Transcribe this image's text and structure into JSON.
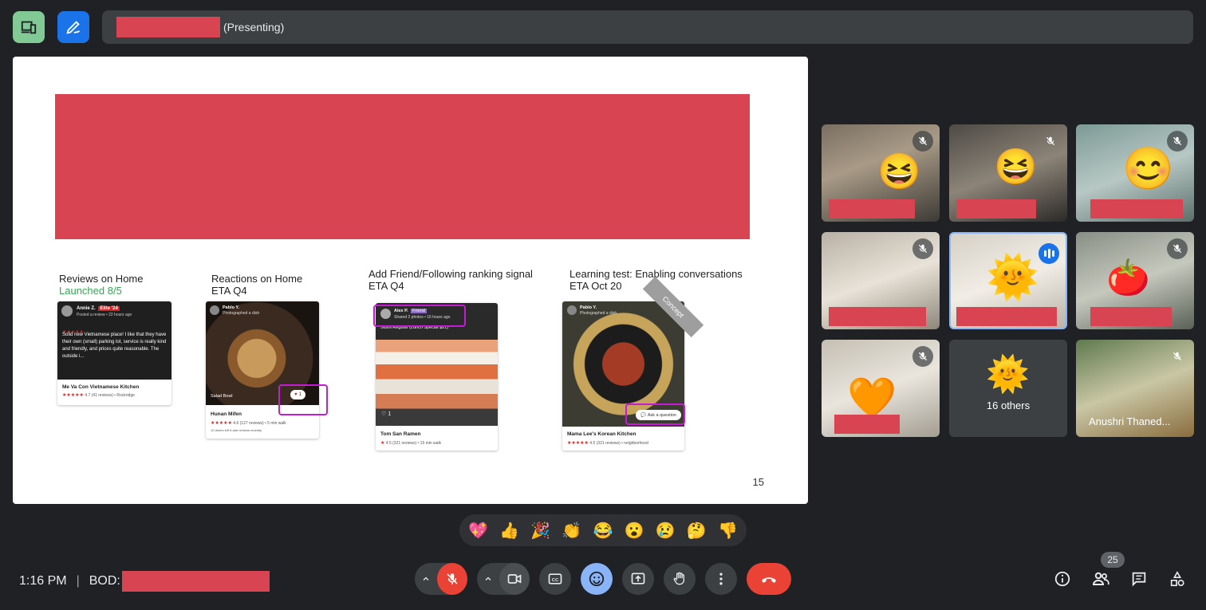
{
  "topbar": {
    "presenting_label": "(Presenting)"
  },
  "slide": {
    "page_number": "15",
    "concept_label": "Concept",
    "features": [
      {
        "title": "Reviews on Home",
        "subtitle": "Launched 8/5"
      },
      {
        "title": "Reactions on Home",
        "subtitle": "ETA Q4"
      },
      {
        "title": "Add Friend/Following ranking signal",
        "subtitle": "ETA Q4"
      },
      {
        "title": "Learning test: Enabling conversations",
        "subtitle": "ETA Oct 20"
      }
    ],
    "card1": {
      "user": "Annie Z.",
      "badge": "Elite '24",
      "posted": "Posted a review • 22 hours ago",
      "review": "Solid new Vietnamese place! I like that they have their own (small) parking lot, service is really kind and friendly, and prices quite reasonable. The outside i...",
      "business": "Me Va Con Vietnamese Kitchen",
      "rating": "4.7 (41 reviews) • Rockridge"
    },
    "card2": {
      "user": "Pablo Y.",
      "action": "Photographed a dish",
      "dish": "Salad Bowl",
      "reaction_count": "1",
      "business": "Hunan Mifen",
      "rating": "4.6 (127 reviews) • 5 min walk",
      "footnote": "10 diners left 5-star reviews recently"
    },
    "card3": {
      "user": "Alex P.",
      "badge": "Friend",
      "action": "Shared 2 photos • 16 hours ago",
      "dish": "Sushi Regular (Lunch Special $21)",
      "likes": "1",
      "business": "Tom San Ramen",
      "rating": "4.5 (321 reviews) • 15 min walk"
    },
    "card4": {
      "user": "Pablo Y.",
      "action": "Photographed a dish",
      "cta": "Ask a question",
      "business": "Mama Lee's Korean Kitchen",
      "rating": "4.5 (321 reviews) • neighborhood"
    }
  },
  "tiles": {
    "others_label": "16 others",
    "named_participant": "Anushri Thaned..."
  },
  "reactions": [
    "💖",
    "👍",
    "🎉",
    "👏",
    "😂",
    "😮",
    "😢",
    "🤔",
    "👎"
  ],
  "bottombar": {
    "time": "1:16 PM",
    "meeting_prefix": "BOD:",
    "participant_count": "25"
  }
}
